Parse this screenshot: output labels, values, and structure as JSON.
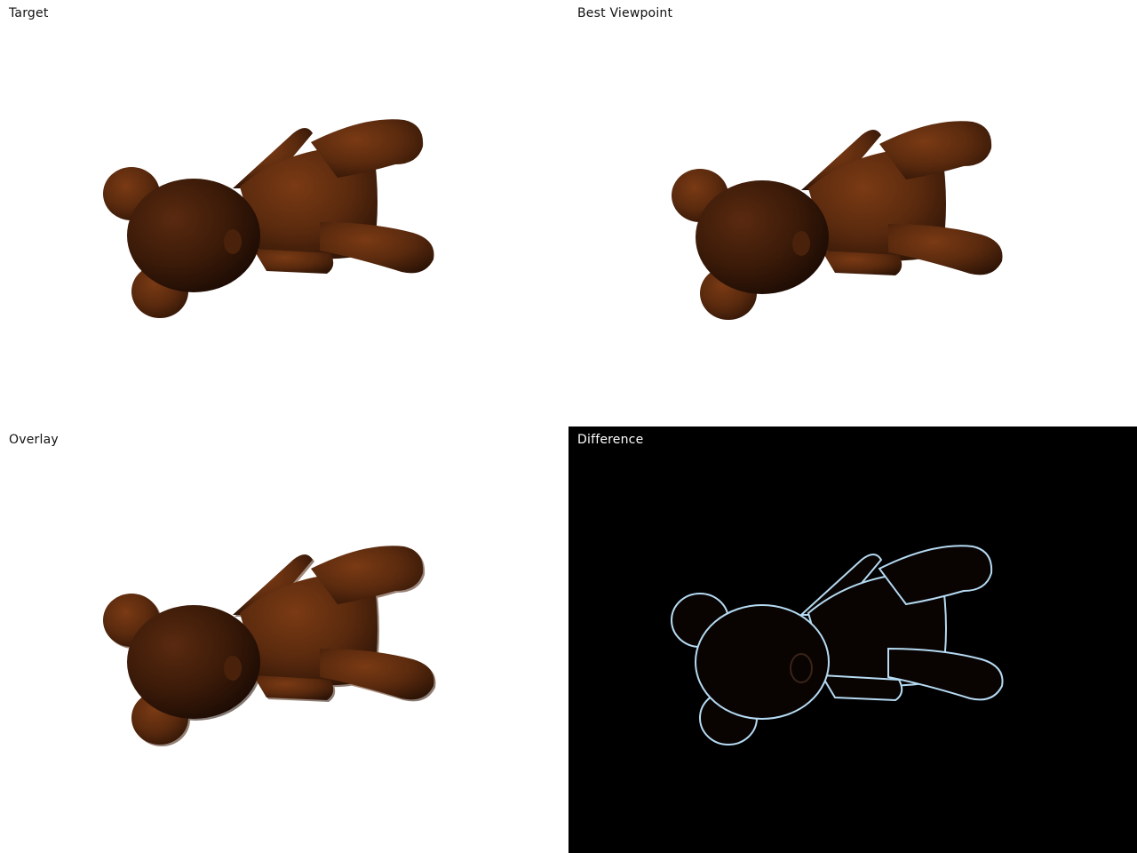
{
  "panels": {
    "target": {
      "label": "Target"
    },
    "best_viewpoint": {
      "label": "Best Viewpoint"
    },
    "overlay": {
      "label": "Overlay"
    },
    "difference": {
      "label": "Difference"
    }
  },
  "colors": {
    "bear_brown": "#5a2a0e",
    "bear_dark": "#2e1406",
    "difference_bg": "#000000",
    "difference_edge": "#bfe6ff"
  }
}
